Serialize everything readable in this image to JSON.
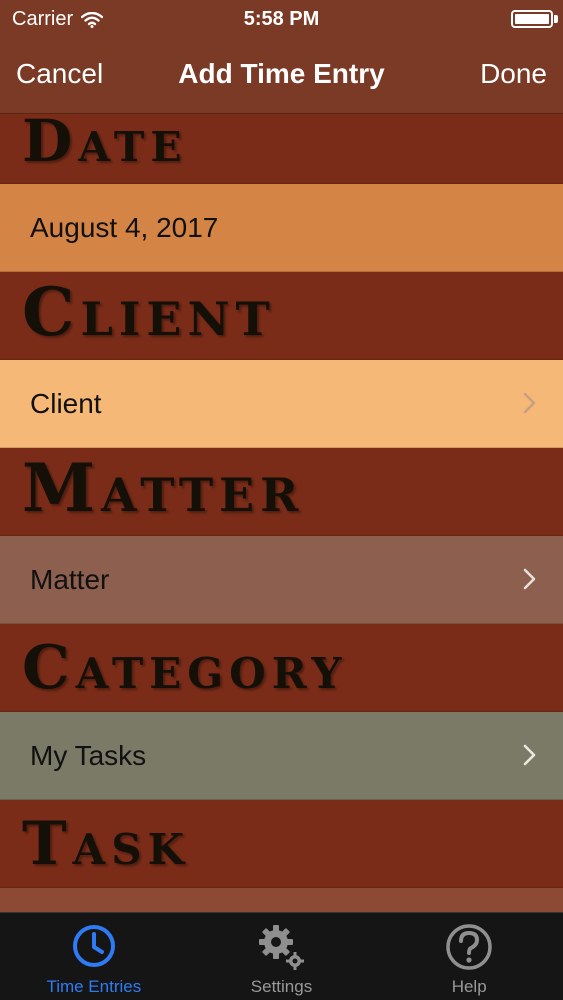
{
  "status_bar": {
    "carrier": "Carrier",
    "time": "5:58 PM",
    "wifi_icon": "wifi-icon",
    "battery_icon": "battery-icon"
  },
  "nav": {
    "cancel": "Cancel",
    "title": "Add Time Entry",
    "done": "Done"
  },
  "sections": {
    "date": {
      "header": "Date",
      "value": "August 4, 2017",
      "row_color": "#d48445"
    },
    "client": {
      "header": "Client",
      "value": "Client",
      "row_color": "#f6b877"
    },
    "matter": {
      "header": "Matter",
      "value": "Matter",
      "row_color": "#8c5f4e"
    },
    "category": {
      "header": "Category",
      "value": "My Tasks",
      "row_color": "#7a7a66"
    },
    "task": {
      "header": "Task"
    }
  },
  "colors": {
    "background": "#7a2c18",
    "nav_bar": "#7a3a25",
    "tab_active": "#2f7bf5",
    "tab_inactive": "#999999"
  },
  "tabs": [
    {
      "label": "Time Entries",
      "icon": "clock-icon",
      "active": true
    },
    {
      "label": "Settings",
      "icon": "gear-icon",
      "active": false
    },
    {
      "label": "Help",
      "icon": "help-icon",
      "active": false
    }
  ]
}
